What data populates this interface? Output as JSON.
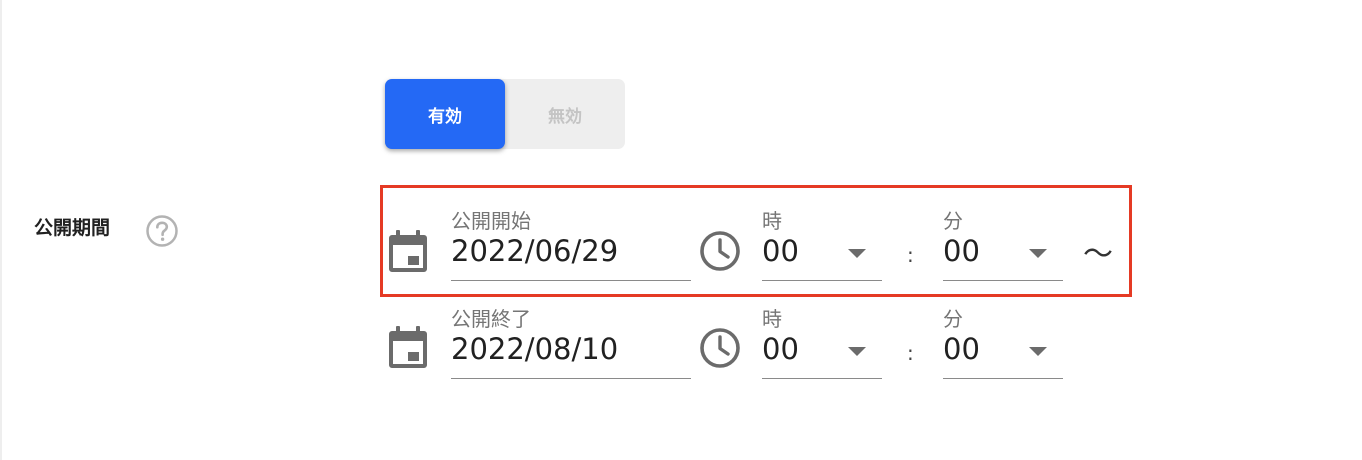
{
  "toggle": {
    "on_label": "有効",
    "off_label": "無効",
    "selected": "有効"
  },
  "period": {
    "label": "公開期間",
    "help_icon": "question-circle-icon",
    "separator": "〜",
    "start": {
      "date_label": "公開開始",
      "date_value": "2022/06/29",
      "hour_label": "時",
      "hour_value": "00",
      "minute_label": "分",
      "minute_value": "00",
      "colon": ":"
    },
    "end": {
      "date_label": "公開終了",
      "date_value": "2022/08/10",
      "hour_label": "時",
      "hour_value": "00",
      "minute_label": "分",
      "minute_value": "00",
      "colon": ":"
    }
  },
  "colors": {
    "accent": "#2469f5",
    "highlight": "#e53a24",
    "icon": "#6b6b6b"
  }
}
